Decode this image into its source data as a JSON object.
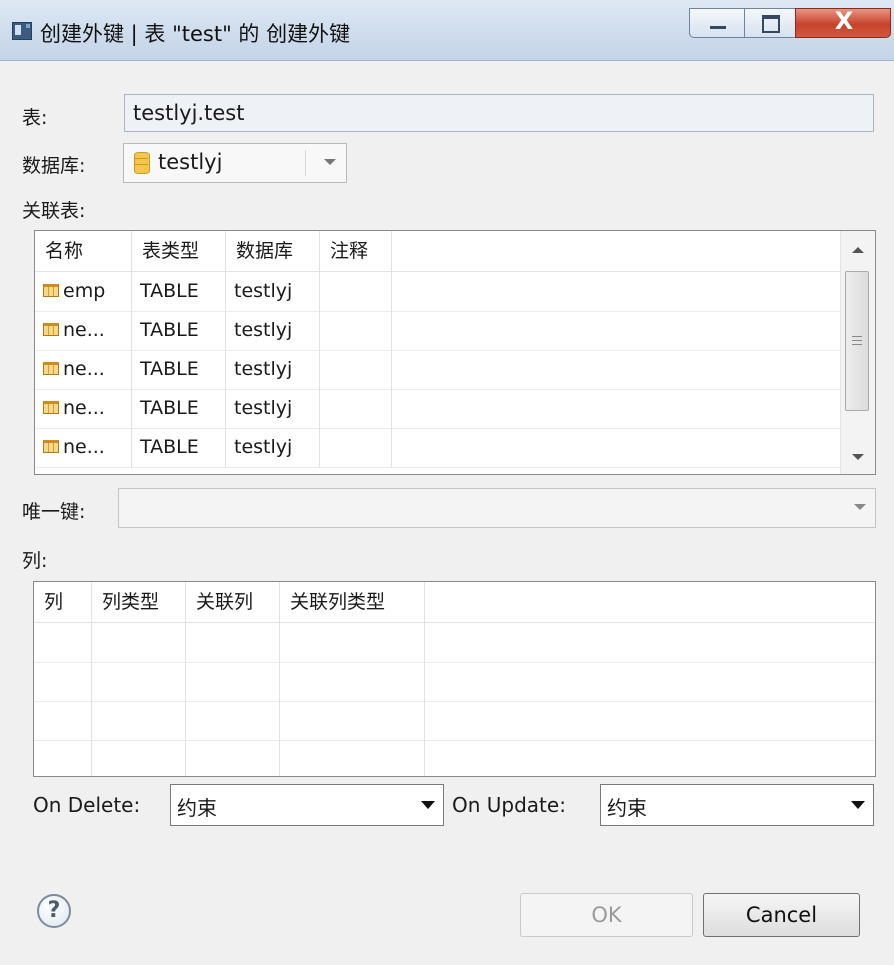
{
  "window": {
    "title": "创建外键 | 表 \"test\" 的 创建外键",
    "close_glyph": "X"
  },
  "form": {
    "table_label": "表:",
    "table_value": "testlyj.test",
    "database_label": "数据库:",
    "database_value": "testlyj",
    "related_table_label": "关联表:",
    "unique_key_label": "唯一键:",
    "unique_key_value": "",
    "columns_label": "列:",
    "on_delete_label": "On Delete:",
    "on_delete_value": "约束",
    "on_update_label": "On Update:",
    "on_update_value": "约束"
  },
  "related_table": {
    "headers": [
      "名称",
      "表类型",
      "数据库",
      "注释"
    ],
    "rows": [
      [
        "emp",
        "TABLE",
        "testlyj",
        ""
      ],
      [
        "ne...",
        "TABLE",
        "testlyj",
        ""
      ],
      [
        "ne...",
        "TABLE",
        "testlyj",
        ""
      ],
      [
        "ne...",
        "TABLE",
        "testlyj",
        ""
      ],
      [
        "ne...",
        "TABLE",
        "testlyj",
        ""
      ]
    ],
    "row_icon": "table-icon"
  },
  "columns_table": {
    "headers": [
      "列",
      "列类型",
      "关联列",
      "关联列类型"
    ],
    "rows": []
  },
  "buttons": {
    "help": "?",
    "ok": "OK",
    "cancel": "Cancel"
  },
  "icons": {
    "window": "dialog-window-icon",
    "database": "database-icon",
    "help": "help-icon"
  }
}
